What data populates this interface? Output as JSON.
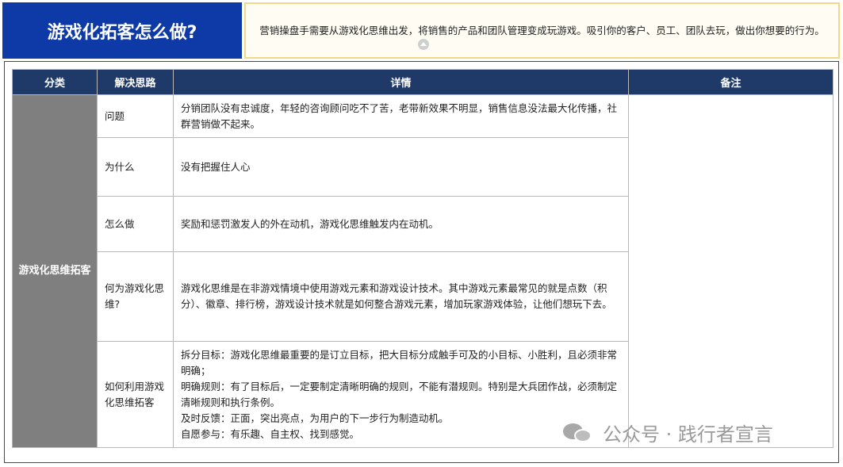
{
  "header": {
    "title": "游戏化拓客怎么做?",
    "intro": "营销操盘手需要从游戏化思维出发，将销售的产品和团队管理变成玩游戏。吸引你的客户、员工、团队去玩，做出你想要的行为。"
  },
  "table": {
    "columns": [
      "分类",
      "解决思路",
      "详情",
      "备注"
    ],
    "category": "游戏化思维拓客",
    "rows": [
      {
        "idea": "问题",
        "detail": "分销团队没有忠诚度，年轻的咨询顾问吃不了苦，老带新效果不明显，销售信息没法最大化传播，社群营销做不起来。"
      },
      {
        "idea": "为什么",
        "detail": "没有把握住人心"
      },
      {
        "idea": "怎么做",
        "detail": "奖励和惩罚激发人的外在动机，游戏化思维触发内在动机。"
      },
      {
        "idea": "何为游戏化思维?",
        "detail": "游戏化思维是在非游戏情境中使用游戏元素和游戏设计技术。其中游戏元素最常见的就是点数（积分）、徽章、排行榜，游戏设计技术就是如何整合游戏元素，增加玩家游戏体验，让他们想玩下去。"
      },
      {
        "idea": "如何利用游戏化思维拓客",
        "detail_lines": [
          "拆分目标：游戏化思维最重要的是订立目标，把大目标分成触手可及的小目标、小胜利，且必须非常明确；",
          "明确规则：有了目标后，一定要制定清晰明确的规则，不能有潜规则。特别是大兵团作战，必须制定清晰规则和执行条例。",
          "及时反馈：正面，突出亮点，为用户的下一步行为制造动机。",
          "自愿参与：有乐趣、自主权、找到感觉。"
        ]
      }
    ],
    "note": ""
  },
  "watermark": {
    "text": "公众号 · 践行者宣言",
    "icon": "wechat-icon"
  }
}
